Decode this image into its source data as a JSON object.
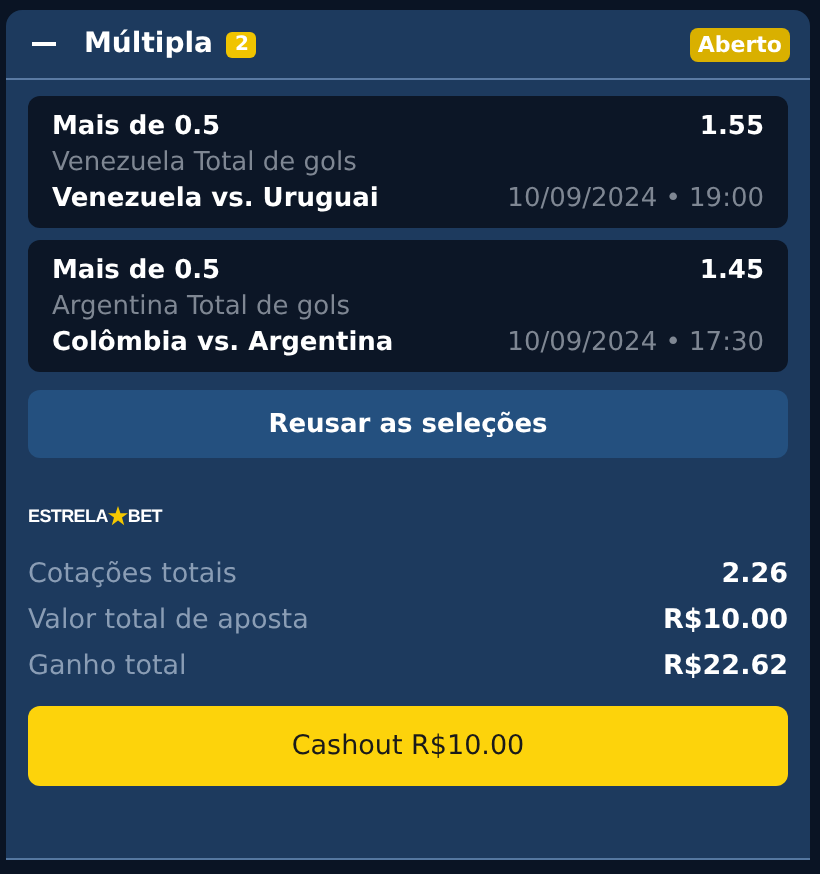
{
  "header": {
    "title": "Múltipla",
    "count": "2",
    "status": "Aberto",
    "expanded": true
  },
  "selections": [
    {
      "market": "Mais de 0.5",
      "odds": "1.55",
      "description": "Venezuela Total de gols",
      "match": "Venezuela vs. Uruguai",
      "datetime": "10/09/2024 • 19:00"
    },
    {
      "market": "Mais de 0.5",
      "odds": "1.45",
      "description": "Argentina Total de gols",
      "match": "Colômbia vs. Argentina",
      "datetime": "10/09/2024 • 17:30"
    }
  ],
  "reuse_button": "Reusar as seleções",
  "brand": {
    "left": "ESTRELA",
    "right": "BET"
  },
  "summary": [
    {
      "label": "Cotações totais",
      "value": "2.26"
    },
    {
      "label": "Valor total de aposta",
      "value": "R$10.00"
    },
    {
      "label": "Ganho total",
      "value": "R$22.62"
    }
  ],
  "cashout_button": "Cashout R$10.00"
}
